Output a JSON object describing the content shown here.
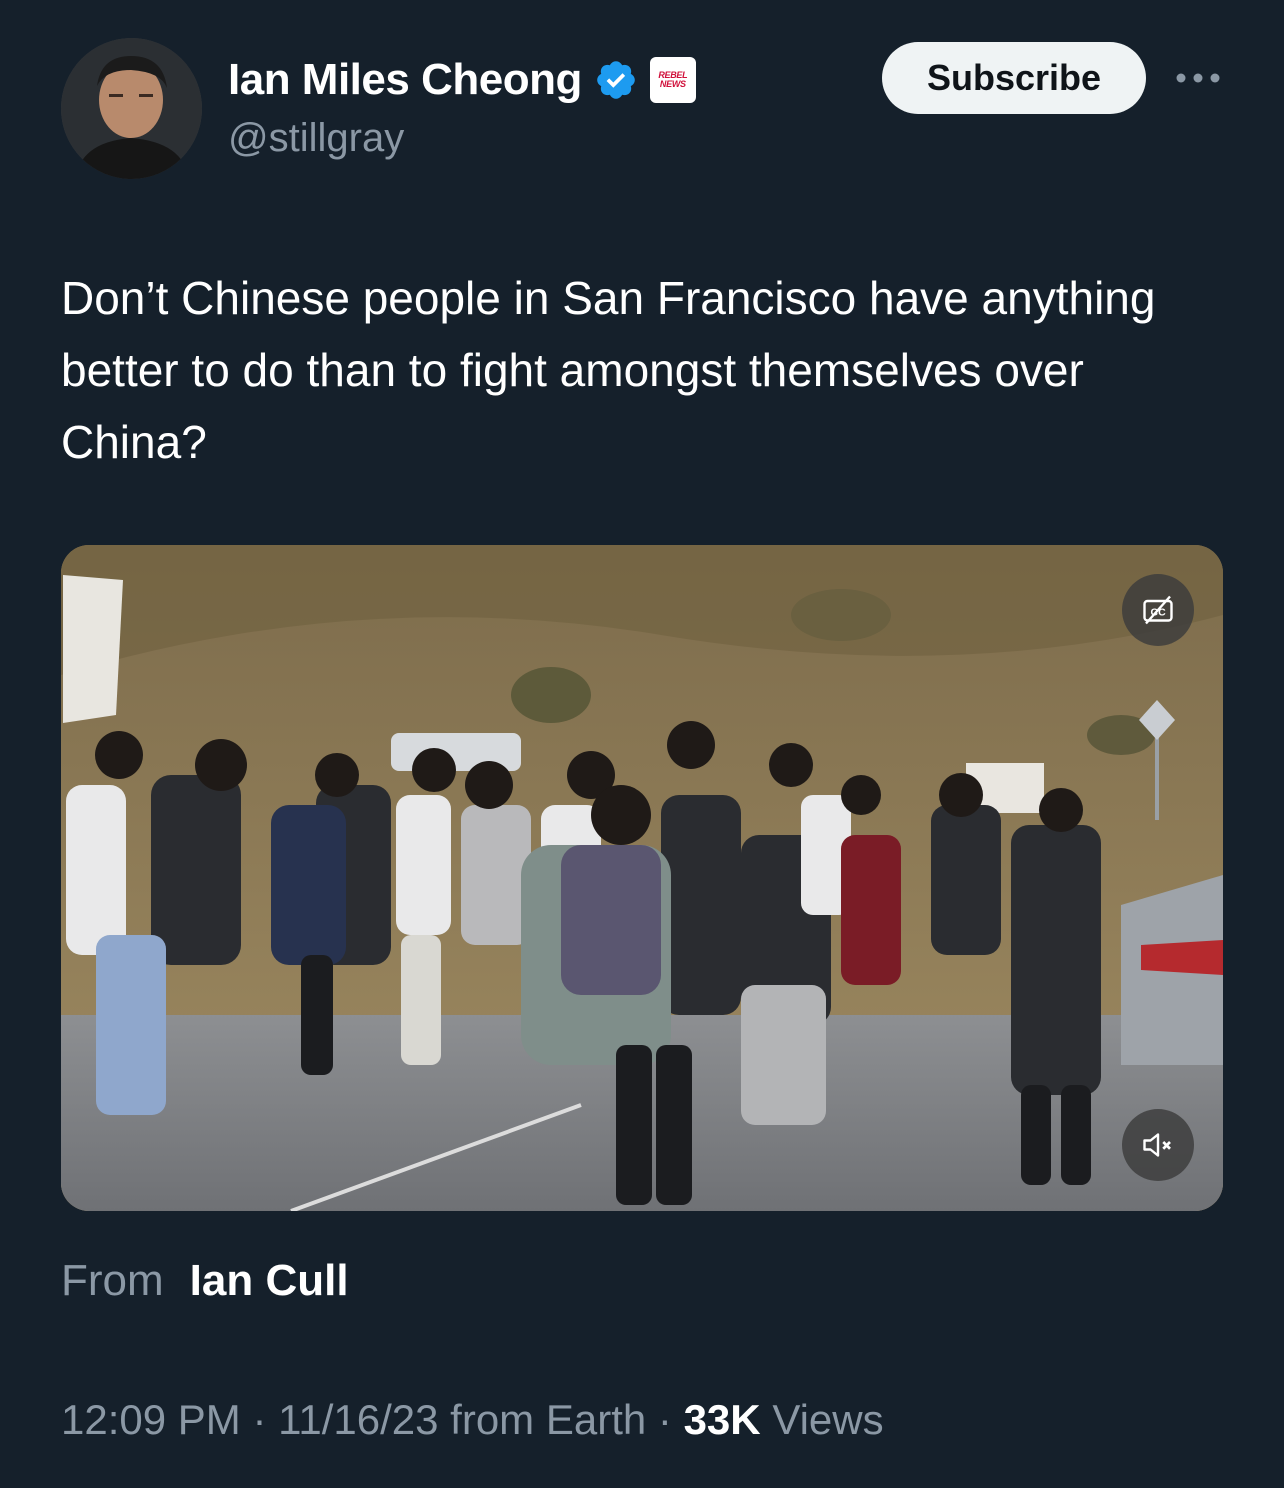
{
  "header": {
    "display_name": "Ian Miles Cheong",
    "handle": "@stillgray",
    "affiliate_badge_text_1": "REBEL",
    "affiliate_badge_text_2": "NEWS",
    "subscribe_label": "Subscribe",
    "verified_color": "#1d9bf0"
  },
  "tweet": {
    "text": "Don’t Chinese people in San Francisco have anything better to do than to fight amongst themselves over China?"
  },
  "media": {
    "type": "video",
    "captions_icon": "captions-off-icon",
    "mute_icon": "volume-muted-icon"
  },
  "attribution": {
    "from_label": "From",
    "from_name": "Ian Cull"
  },
  "meta": {
    "time": "12:09 PM",
    "separator": "·",
    "date": "11/16/23",
    "source": "from Earth",
    "views_count": "33K",
    "views_label": "Views"
  },
  "colors": {
    "background": "#15202b",
    "secondary_text": "#8b98a5",
    "accent": "#1d9bf0"
  }
}
